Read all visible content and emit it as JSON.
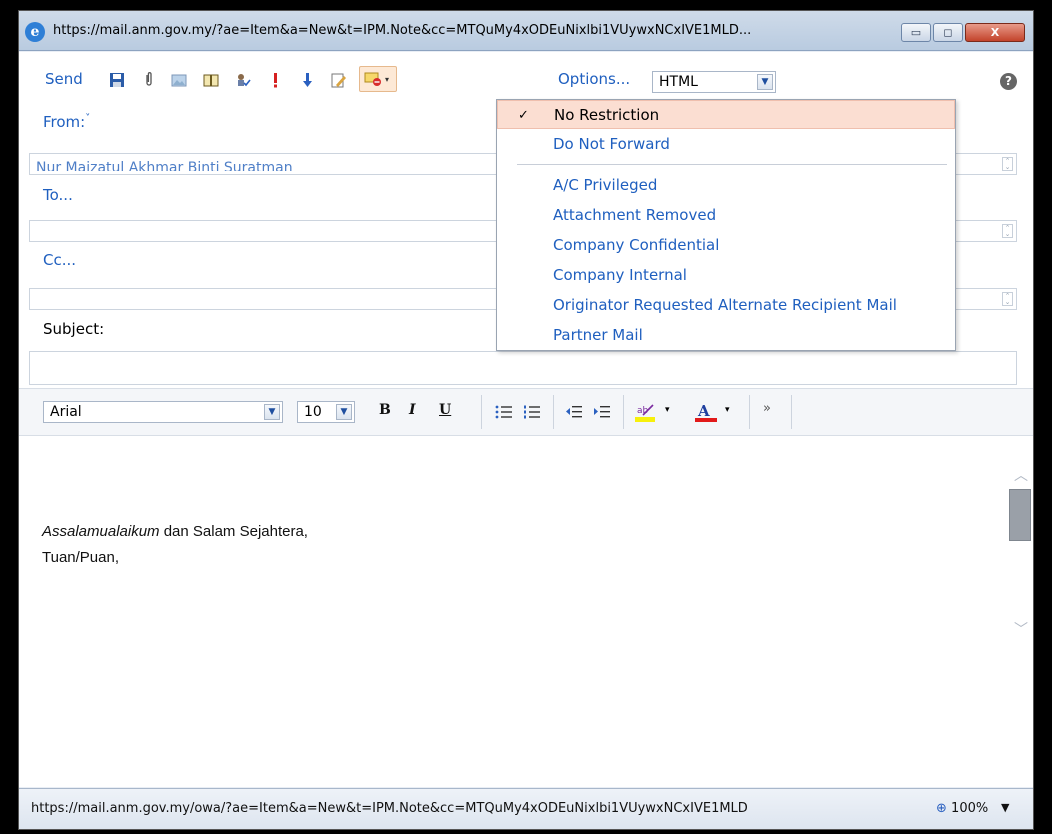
{
  "window": {
    "title": "https://mail.anm.gov.my/?ae=Item&a=New&t=IPM.Note&cc=MTQuMy4xODEuNixlbi1VUywxNCxIVE1MLD...",
    "min_symbol": "▭",
    "max_symbol": "◻",
    "close_symbol": "X"
  },
  "toolbar": {
    "send_label": "Send",
    "options_label": "Options...",
    "format_value": "HTML",
    "help_symbol": "?"
  },
  "fields": {
    "from_label": "From:",
    "from_value": "Nur Maizatul Akhmar Binti Suratman",
    "to_label": "To...",
    "cc_label": "Cc...",
    "subject_label": "Subject:"
  },
  "format_bar": {
    "font": "Arial",
    "size": "10",
    "bold": "B",
    "italic": "I",
    "underline": "U"
  },
  "body": {
    "line1_italic": "Assalamualaikum",
    "line1_rest": " dan Salam Sejahtera,",
    "line2": "Tuan/Puan,"
  },
  "permission_menu": {
    "items": [
      {
        "label": "No Restriction",
        "selected": true
      },
      {
        "label": "Do Not Forward",
        "selected": false
      },
      {
        "label": "A/C Privileged",
        "selected": false
      },
      {
        "label": "Attachment Removed",
        "selected": false
      },
      {
        "label": "Company Confidential",
        "selected": false
      },
      {
        "label": "Company Internal",
        "selected": false
      },
      {
        "label": "Originator Requested Alternate Recipient Mail",
        "selected": false
      },
      {
        "label": "Partner Mail",
        "selected": false
      }
    ]
  },
  "status_bar": {
    "url": "https://mail.anm.gov.my/owa/?ae=Item&a=New&t=IPM.Note&cc=MTQuMy4xODEuNixlbi1VUywxNCxIVE1MLD",
    "zoom": "100%"
  },
  "icons": {
    "save": "save-icon",
    "attach": "paperclip-icon",
    "image": "image-icon",
    "address_book": "address-book-icon",
    "check_names": "check-names-icon",
    "high_importance": "high-importance-icon",
    "low_importance": "low-importance-icon",
    "signature": "signature-icon",
    "permission": "permission-icon"
  },
  "colors": {
    "link_blue": "#1f5fbf",
    "menu_selected_bg": "#fbded2"
  }
}
